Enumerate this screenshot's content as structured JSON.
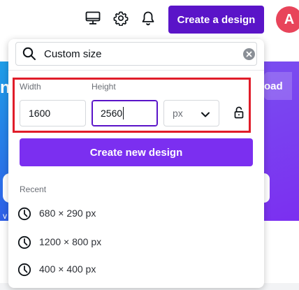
{
  "header": {
    "create_label": "Create a design",
    "avatar_initial": "A",
    "icons": [
      "desktop-icon",
      "gear-icon",
      "bell-icon"
    ]
  },
  "background": {
    "upload_fragment": "oad",
    "side_text": "n",
    "v_text": "v"
  },
  "popover": {
    "search": {
      "value": "Custom size",
      "placeholder": "Custom size"
    },
    "width_label": "Width",
    "height_label": "Height",
    "width_value": "1600",
    "height_value": "2560",
    "unit_value": "px",
    "create_label": "Create new design",
    "recent_label": "Recent",
    "recent": [
      {
        "label": "680 × 290 px"
      },
      {
        "label": "1200 × 800 px"
      },
      {
        "label": "400 × 400 px"
      }
    ]
  },
  "colors": {
    "brand_dark": "#5a14c8",
    "brand": "#7b2ff0",
    "avatar": "#e8445a",
    "highlight": "#e01d2a"
  }
}
